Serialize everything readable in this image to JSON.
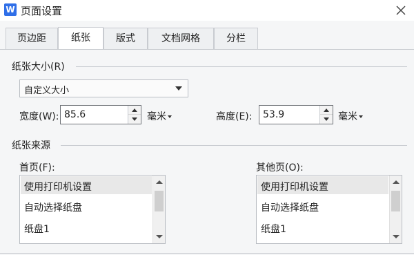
{
  "window": {
    "app_icon_letter": "W",
    "title": "页面设置",
    "close_icon": "close-icon"
  },
  "tabs": [
    {
      "label": "页边距",
      "active": false
    },
    {
      "label": "纸张",
      "active": true
    },
    {
      "label": "版式",
      "active": false
    },
    {
      "label": "文档网格",
      "active": false
    },
    {
      "label": "分栏",
      "active": false
    }
  ],
  "paper_size": {
    "section_label": "纸张大小(R)",
    "selected": "自定义大小",
    "width_label": "宽度(W):",
    "width_value": "85.6",
    "width_unit": "毫米",
    "height_label": "高度(E):",
    "height_value": "53.9",
    "height_unit": "毫米"
  },
  "paper_source": {
    "section_label": "纸张来源",
    "first_page": {
      "label": "首页(F):",
      "items": [
        "使用打印机设置",
        "自动选择纸盘",
        "纸盘1"
      ]
    },
    "other_pages": {
      "label": "其他页(O):",
      "items": [
        "使用打印机设置",
        "自动选择纸盘",
        "纸盘1"
      ]
    }
  },
  "colors": {
    "app_icon_bg": "#2f6fe8",
    "border": "#c8cbd0"
  }
}
